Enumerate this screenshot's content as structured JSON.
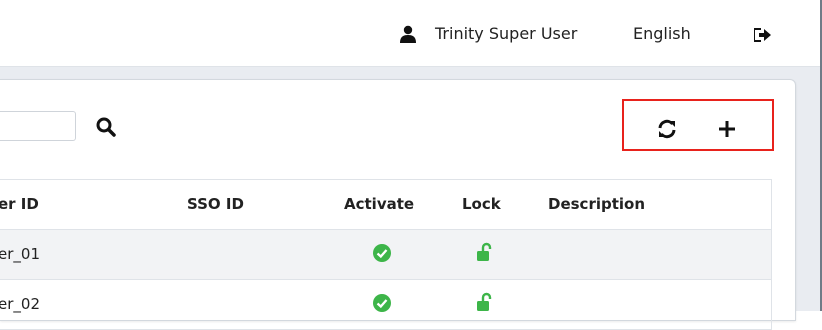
{
  "header": {
    "user_name": "Trinity Super User",
    "language": "English",
    "icons": {
      "user": "user-icon",
      "logout": "logout-icon"
    }
  },
  "toolbar": {
    "search": {
      "value": "",
      "placeholder": ""
    },
    "icons": {
      "search": "search-icon",
      "refresh": "refresh-icon",
      "add": "plus-icon"
    }
  },
  "table": {
    "columns": [
      "er ID",
      "SSO ID",
      "Activate",
      "Lock",
      "Description"
    ],
    "rows": [
      {
        "user_id": "er_01",
        "sso_id": "",
        "activate": "check-circle-icon",
        "lock": "unlock-icon",
        "description": ""
      },
      {
        "user_id": "er_02",
        "sso_id": "",
        "activate": "check-circle-icon",
        "lock": "unlock-icon",
        "description": ""
      }
    ]
  },
  "colors": {
    "accent_green": "#3db549",
    "highlight_red": "#e8221c",
    "page_background": "#e9ecf1",
    "row_alt": "#f2f3f5"
  }
}
